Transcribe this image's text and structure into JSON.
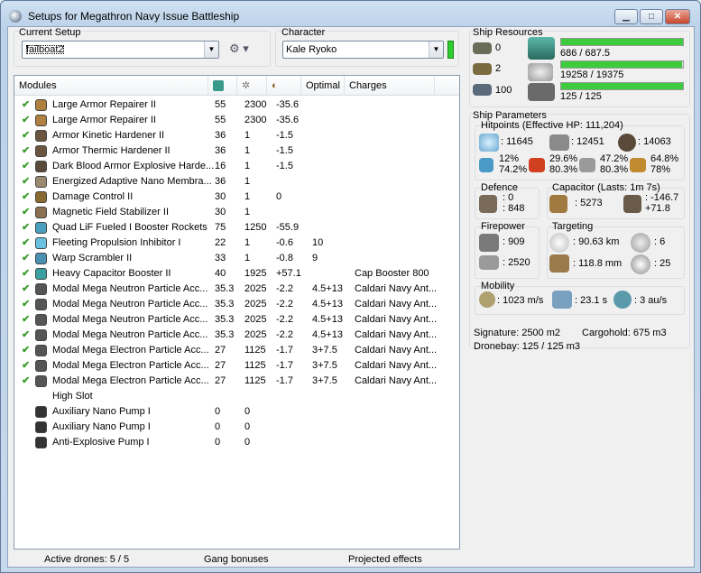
{
  "window": {
    "title": "Setups for Megathron Navy Issue Battleship",
    "minimize": "▁",
    "maximize": "□",
    "close": "✕"
  },
  "setup": {
    "label": "Current Setup",
    "value": "failboat2"
  },
  "character": {
    "label": "Character",
    "value": "Kale Ryoko"
  },
  "columns": {
    "modules": "Modules",
    "optimal": "Optimal",
    "charges": "Charges"
  },
  "modules": [
    {
      "check": "✔",
      "name": "Large Armor Repairer II",
      "cpu": "55",
      "pg": "2300",
      "cap": "-35.6",
      "optimal": "",
      "charges": "",
      "color": "#b08040"
    },
    {
      "check": "✔",
      "name": "Large Armor Repairer II",
      "cpu": "55",
      "pg": "2300",
      "cap": "-35.6",
      "optimal": "",
      "charges": "",
      "color": "#b08040"
    },
    {
      "check": "✔",
      "name": "Armor Kinetic Hardener II",
      "cpu": "36",
      "pg": "1",
      "cap": "-1.5",
      "optimal": "",
      "charges": "",
      "color": "#6b5540"
    },
    {
      "check": "✔",
      "name": "Armor Thermic Hardener II",
      "cpu": "36",
      "pg": "1",
      "cap": "-1.5",
      "optimal": "",
      "charges": "",
      "color": "#6b5540"
    },
    {
      "check": "✔",
      "name": "Dark Blood Armor Explosive Harde...",
      "cpu": "16",
      "pg": "1",
      "cap": "-1.5",
      "optimal": "",
      "charges": "",
      "color": "#5a4a3a"
    },
    {
      "check": "✔",
      "name": "Energized Adaptive Nano Membra...",
      "cpu": "36",
      "pg": "1",
      "cap": "",
      "optimal": "",
      "charges": "",
      "color": "#9a8a70"
    },
    {
      "check": "✔",
      "name": "Damage Control II",
      "cpu": "30",
      "pg": "1",
      "cap": "0",
      "optimal": "",
      "charges": "",
      "color": "#8a6a30"
    },
    {
      "check": "✔",
      "name": "Magnetic Field Stabilizer II",
      "cpu": "30",
      "pg": "1",
      "cap": "",
      "optimal": "",
      "charges": "",
      "color": "#8a7050"
    },
    {
      "check": "✔",
      "name": "Quad LiF Fueled I Booster Rockets",
      "cpu": "75",
      "pg": "1250",
      "cap": "-55.9",
      "optimal": "",
      "charges": "",
      "color": "#4aa0c0"
    },
    {
      "check": "✔",
      "name": "Fleeting Propulsion Inhibitor I",
      "cpu": "22",
      "pg": "1",
      "cap": "-0.6",
      "optimal": "10",
      "charges": "",
      "color": "#6ac0e0"
    },
    {
      "check": "✔",
      "name": "Warp Scrambler II",
      "cpu": "33",
      "pg": "1",
      "cap": "-0.8",
      "optimal": "9",
      "charges": "",
      "color": "#4a90b0"
    },
    {
      "check": "✔",
      "name": "Heavy Capacitor Booster II",
      "cpu": "40",
      "pg": "1925",
      "cap": "+57.1",
      "optimal": "",
      "charges": "Cap Booster 800",
      "color": "#3aa0a0"
    },
    {
      "check": "✔",
      "name": "Modal Mega Neutron Particle Acc...",
      "cpu": "35.3",
      "pg": "2025",
      "cap": "-2.2",
      "optimal": "4.5+13",
      "charges": "Caldari Navy Ant...",
      "color": "#555"
    },
    {
      "check": "✔",
      "name": "Modal Mega Neutron Particle Acc...",
      "cpu": "35.3",
      "pg": "2025",
      "cap": "-2.2",
      "optimal": "4.5+13",
      "charges": "Caldari Navy Ant...",
      "color": "#555"
    },
    {
      "check": "✔",
      "name": "Modal Mega Neutron Particle Acc...",
      "cpu": "35.3",
      "pg": "2025",
      "cap": "-2.2",
      "optimal": "4.5+13",
      "charges": "Caldari Navy Ant...",
      "color": "#555"
    },
    {
      "check": "✔",
      "name": "Modal Mega Neutron Particle Acc...",
      "cpu": "35.3",
      "pg": "2025",
      "cap": "-2.2",
      "optimal": "4.5+13",
      "charges": "Caldari Navy Ant...",
      "color": "#555"
    },
    {
      "check": "✔",
      "name": "Modal Mega Electron Particle Acc...",
      "cpu": "27",
      "pg": "1125",
      "cap": "-1.7",
      "optimal": "3+7.5",
      "charges": "Caldari Navy Ant...",
      "color": "#555"
    },
    {
      "check": "✔",
      "name": "Modal Mega Electron Particle Acc...",
      "cpu": "27",
      "pg": "1125",
      "cap": "-1.7",
      "optimal": "3+7.5",
      "charges": "Caldari Navy Ant...",
      "color": "#555"
    },
    {
      "check": "✔",
      "name": "Modal Mega Electron Particle Acc...",
      "cpu": "27",
      "pg": "1125",
      "cap": "-1.7",
      "optimal": "3+7.5",
      "charges": "Caldari Navy Ant...",
      "color": "#555"
    },
    {
      "check": "",
      "name": "High Slot",
      "cpu": "",
      "pg": "",
      "cap": "",
      "optimal": "",
      "charges": "",
      "color": "#fff"
    },
    {
      "check": "",
      "name": "Auxiliary Nano Pump I",
      "cpu": "0",
      "pg": "0",
      "cap": "",
      "optimal": "",
      "charges": "",
      "color": "#333"
    },
    {
      "check": "",
      "name": "Auxiliary Nano Pump I",
      "cpu": "0",
      "pg": "0",
      "cap": "",
      "optimal": "",
      "charges": "",
      "color": "#333"
    },
    {
      "check": "",
      "name": "Anti-Explosive Pump I",
      "cpu": "0",
      "pg": "0",
      "cap": "",
      "optimal": "",
      "charges": "",
      "color": "#333"
    }
  ],
  "resources": {
    "label": "Ship Resources",
    "turrets": "0",
    "launchers": "2",
    "calibration": "100",
    "cpu": {
      "text": "686 / 687.5",
      "fraction": 0.998
    },
    "powergrid": {
      "text": "19258 / 19375",
      "fraction": 0.994
    },
    "drone_bw": {
      "text": "125 / 125",
      "fraction": 1.0
    }
  },
  "params": {
    "label": "Ship Parameters",
    "hitpoints": {
      "label": "Hitpoints (Effective HP: 111,204)",
      "shield": ": 11645",
      "armor": ": 12451",
      "hull": ": 14063",
      "shield_rec": "12%",
      "shield_rec2": "74.2%",
      "armor_res": "29.6%",
      "armor_res2": "80.3%",
      "em": "47.2%",
      "em2": "80.3%",
      "exp": "64.8%",
      "exp2": "78%"
    },
    "defence": {
      "label": "Defence",
      "tank": ": 0",
      "tank2": ": 848"
    },
    "capacitor": {
      "label": "Capacitor (Lasts: 1m 7s)",
      "amount": ": 5273",
      "delta": ": -146.7",
      "delta2": "+71.8"
    },
    "firepower": {
      "label": "Firepower",
      "turret": ": 909",
      "missile": ": 2520"
    },
    "targeting": {
      "label": "Targeting",
      "range": ": 90.63 km",
      "targets": ": 6",
      "scan": ": 118.8 mm",
      "sensor": ": 25"
    },
    "mobility": {
      "label": "Mobility",
      "speed": ": 1023 m/s",
      "align": ": 23.1 s",
      "warp": ": 3 au/s"
    },
    "signature": "Signature: 2500 m2",
    "cargohold": "Cargohold: 675 m3",
    "dronebay": "Dronebay: 125 / 125 m3"
  },
  "status": {
    "drones": "Active drones: 5 / 5",
    "gang": "Gang bonuses",
    "projected": "Projected effects"
  },
  "colors": {
    "accent": "#3ccc3c",
    "check": "#3a9d2c"
  }
}
